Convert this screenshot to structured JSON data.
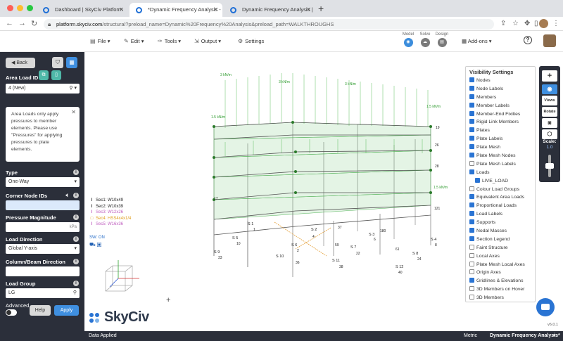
{
  "browser": {
    "tabs": [
      {
        "label": "Dashboard | SkyCiv Platform",
        "active": false
      },
      {
        "label": "*Dynamic Frequency Analysis -",
        "active": true
      },
      {
        "label": "Dynamic Frequency Analysis |",
        "active": false
      }
    ],
    "new_tab": "+",
    "url_host": "platform.skyciv.com",
    "url_path": "/structural?preload_name=Dynamic%20Frequency%20Analysis&preload_path=WALKTHROUGHS"
  },
  "toolbar": {
    "menus": [
      {
        "label": "File",
        "icon": "file-icon"
      },
      {
        "label": "Edit",
        "icon": "pencil-icon"
      },
      {
        "label": "Tools",
        "icon": "wrench-icon"
      },
      {
        "label": "Output",
        "icon": "output-icon"
      },
      {
        "label": "Settings",
        "icon": "gear-icon"
      }
    ],
    "modes": [
      {
        "label": "Model",
        "active": true
      },
      {
        "label": "Solve",
        "active": false
      },
      {
        "label": "Design",
        "active": false
      }
    ],
    "addons_label": "Add-ons",
    "help_label": "?"
  },
  "left_panel": {
    "back_label": "Back",
    "area_load_id_label": "Area Load ID",
    "area_load_id_value": "4 (New)",
    "note": "Area Loads only apply pressures to member elements. Please use \"Pressures\" for applying pressures to plate elements.",
    "type_label": "Type",
    "type_value": "One-Way",
    "corner_nodes_label": "Corner Node IDs",
    "corner_nodes_value": "",
    "pressure_label": "Pressure Magnitude",
    "pressure_value": "",
    "pressure_unit": "kPa",
    "load_direction_label": "Load Direction",
    "load_direction_value": "Global Y-axis",
    "column_beam_label": "Column/Beam Direction",
    "column_beam_value": "",
    "load_group_label": "Load Group",
    "load_group_value": "LG",
    "advanced_label": "Advanced",
    "help_button": "Help",
    "apply_button": "Apply"
  },
  "section_legend": [
    {
      "label": "Sec1: W10x49",
      "color": "#333333"
    },
    {
      "label": "Sec2: W10x39",
      "color": "#333333"
    },
    {
      "label": "Sec3: W12x26",
      "color": "#c060c0"
    },
    {
      "label": "Sec4: HSS4x4x1/4",
      "color": "#e0a020"
    },
    {
      "label": "Sec5: W16x36",
      "color": "#c060c0"
    }
  ],
  "sw_label": "SW: ON",
  "visibility": {
    "title": "Visibility Settings",
    "items": [
      {
        "label": "Nodes",
        "checked": true
      },
      {
        "label": "Node Labels",
        "checked": true
      },
      {
        "label": "Members",
        "checked": true
      },
      {
        "label": "Member Labels",
        "checked": true
      },
      {
        "label": "Member-End Fixities",
        "checked": true
      },
      {
        "label": "Rigid Link Members",
        "checked": true
      },
      {
        "label": "Plates",
        "checked": true
      },
      {
        "label": "Plate Labels",
        "checked": true
      },
      {
        "label": "Plate Mesh",
        "checked": true
      },
      {
        "label": "Plate Mesh Nodes",
        "checked": true
      },
      {
        "label": "Plate Mesh Labels",
        "checked": false
      },
      {
        "label": "Loads",
        "checked": true
      },
      {
        "label": "LIVE_LOAD",
        "checked": true,
        "indent": true
      },
      {
        "label": "Colour Load Groups",
        "checked": false
      },
      {
        "label": "Equivalent Area Loads",
        "checked": true
      },
      {
        "label": "Proportional Loads",
        "checked": true
      },
      {
        "label": "Load Labels",
        "checked": true
      },
      {
        "label": "Supports",
        "checked": true
      },
      {
        "label": "Nodal Masses",
        "checked": true
      },
      {
        "label": "Section Legend",
        "checked": true
      },
      {
        "label": "Faint Structure",
        "checked": false
      },
      {
        "label": "Local Axes",
        "checked": false
      },
      {
        "label": "Plate Mesh Local Axes",
        "checked": false
      },
      {
        "label": "Origin Axes",
        "checked": false
      },
      {
        "label": "Gridlines & Elevations",
        "checked": true
      },
      {
        "label": "3D Members on Hover",
        "checked": false
      },
      {
        "label": "3D Members",
        "checked": false
      }
    ]
  },
  "right_tools": {
    "plus": "+",
    "views": "Views",
    "rotate": "Rotate",
    "scale_label": "Scale:",
    "scale_value": "1.0"
  },
  "model_labels": {
    "load_labels": [
      "3 kN/m",
      "3 kN/m",
      "3 kN/m",
      "1.5 kN/m",
      "1.5 kN/m",
      "1.5 kN/m"
    ],
    "supports": [
      "S 9",
      "S 5",
      "S 1",
      "S 6",
      "S 2",
      "S 3",
      "S 7",
      "S 10",
      "S 11",
      "S 8",
      "S 4",
      "S 12"
    ],
    "nodes": [
      "33",
      "10",
      "1",
      "36",
      "2",
      "4",
      "38",
      "22",
      "6",
      "24",
      "8",
      "40",
      "19",
      "121",
      "180",
      "26",
      "28",
      "17",
      "37",
      "59",
      "61"
    ]
  },
  "version": "v6.0.1",
  "footer": {
    "status": "Data Applied",
    "units": "Metric",
    "filename": "Dynamic Frequency Analysis*"
  },
  "brand": {
    "name": "SkyCiv",
    "accent": "#2a74d3",
    "panel": "#2b2f3a"
  }
}
